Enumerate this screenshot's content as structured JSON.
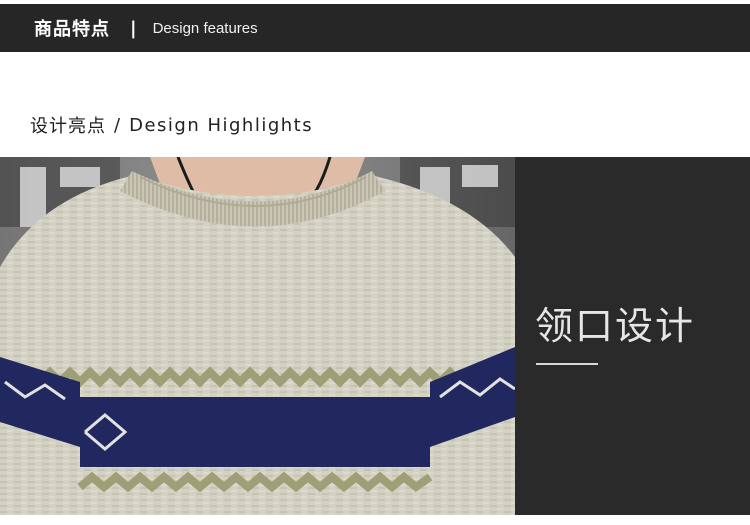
{
  "header": {
    "title_cn": "商品特点",
    "separator": "|",
    "title_en": "Design features"
  },
  "section": {
    "title_cn": "设计亮点",
    "slash": "/",
    "title_en": "Design Highlights"
  },
  "feature": {
    "title": "领口设计"
  },
  "photo": {
    "icon": "sweater-neckline-photo",
    "colors": {
      "knit": "#d9d6c8",
      "navy": "#232a63",
      "olive": "#a5a67c",
      "panel": "#2a2a2a",
      "header": "#262626"
    }
  }
}
